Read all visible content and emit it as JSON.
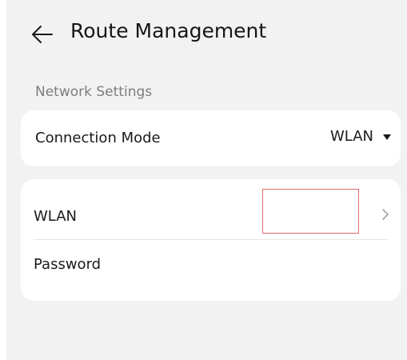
{
  "header": {
    "title": "Route Management",
    "back_icon": "back-arrow-icon"
  },
  "section": {
    "label": "Network Settings"
  },
  "connection_mode": {
    "label": "Connection Mode",
    "value": "WLAN",
    "dropdown_icon": "caret-down-icon"
  },
  "wlan": {
    "label": "WLAN",
    "value": "",
    "chevron_icon": "chevron-right-icon",
    "highlight_color": "#e26b6b"
  },
  "password": {
    "label": "Password",
    "value": ""
  },
  "colors": {
    "background": "#f2f2f2",
    "card": "#ffffff",
    "section_label": "#7d7d7d"
  }
}
